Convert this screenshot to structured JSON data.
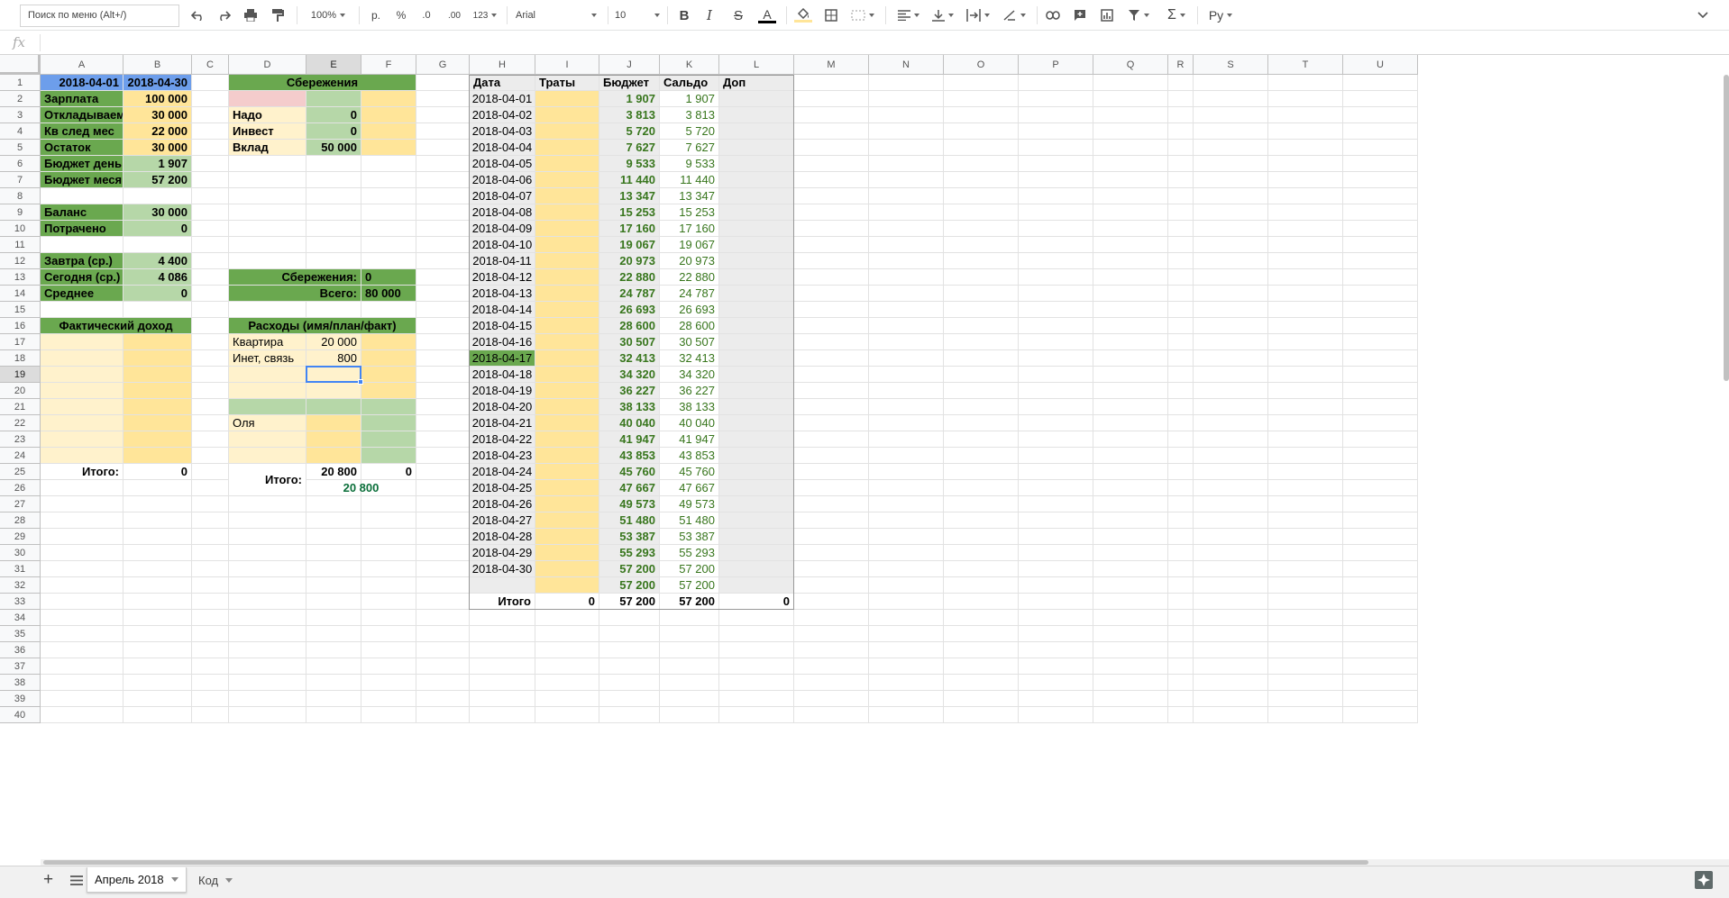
{
  "toolbar": {
    "search_placeholder": "Поиск по меню (Alt+/)",
    "zoom": "100%",
    "currency": "р.",
    "percent": "%",
    "dec_less": ".0",
    "dec_more": ".00",
    "format_more": "123",
    "font": "Arial",
    "font_size": "10",
    "input_tool": "Ру"
  },
  "formula_bar": {
    "fx": "fx",
    "value": ""
  },
  "columns": [
    "A",
    "B",
    "C",
    "D",
    "E",
    "F",
    "G",
    "H",
    "I",
    "J",
    "K",
    "L",
    "M",
    "N",
    "O",
    "P",
    "Q",
    "R",
    "S",
    "T",
    "U"
  ],
  "rows_count": 40,
  "colors": {
    "green_dark": "#6aa84f",
    "green_light": "#b6d7a8",
    "yellow_light": "#fff2cc",
    "yellow": "#ffe599",
    "blue": "#6d9eeb",
    "pink": "#ead1dc",
    "red_light": "#f4cccc",
    "gray": "#ececec",
    "text_green": "#38761d",
    "text_teal": "#0b6f3a"
  },
  "cells": [
    [
      "A1",
      "2018-04-01",
      "b",
      "bl",
      "r"
    ],
    [
      "B1",
      "2018-04-30",
      "b",
      "bl",
      "r"
    ],
    [
      "D1",
      "Сбережения",
      "b",
      "gd",
      "c",
      "span3"
    ],
    [
      "H1",
      "Дата",
      "b",
      "gy"
    ],
    [
      "I1",
      "Траты",
      "b",
      "gy"
    ],
    [
      "J1",
      "Бюджет",
      "b",
      "gy"
    ],
    [
      "K1",
      "Сальдо",
      "b",
      "gy"
    ],
    [
      "L1",
      "Доп",
      "b",
      "gy"
    ],
    [
      "A2",
      "Зарплата",
      "b",
      "gd"
    ],
    [
      "B2",
      "100 000",
      "b",
      "ye",
      "r"
    ],
    [
      "D2",
      "",
      "",
      "rl"
    ],
    [
      "E2",
      "",
      "",
      "gl"
    ],
    [
      "F2",
      "",
      "",
      "ye"
    ],
    [
      "A3",
      "Откладываем",
      "b",
      "gd"
    ],
    [
      "B3",
      "30 000",
      "b",
      "ye",
      "r"
    ],
    [
      "D3",
      "Надо",
      "b",
      "yl"
    ],
    [
      "E3",
      "0",
      "b",
      "gl",
      "r"
    ],
    [
      "F3",
      "",
      "",
      "ye"
    ],
    [
      "A4",
      "Кв след мес",
      "b",
      "gd"
    ],
    [
      "B4",
      "22 000",
      "b",
      "ye",
      "r"
    ],
    [
      "D4",
      "Инвест",
      "b",
      "yl"
    ],
    [
      "E4",
      "0",
      "b",
      "gl",
      "r"
    ],
    [
      "F4",
      "",
      "",
      "ye"
    ],
    [
      "A5",
      "Остаток",
      "b",
      "gd"
    ],
    [
      "B5",
      "30 000",
      "b",
      "ye",
      "r"
    ],
    [
      "D5",
      "Вклад",
      "b",
      "yl"
    ],
    [
      "E5",
      "50 000",
      "b",
      "gl",
      "r"
    ],
    [
      "F5",
      "",
      "",
      "ye"
    ],
    [
      "A6",
      "Бюджет день",
      "b",
      "gd"
    ],
    [
      "B6",
      "1 907",
      "b",
      "gl",
      "r"
    ],
    [
      "A7",
      "Бюджет месяц",
      "b",
      "gd"
    ],
    [
      "B7",
      "57 200",
      "b",
      "gl",
      "r"
    ],
    [
      "A9",
      "Баланс",
      "b",
      "gd"
    ],
    [
      "B9",
      "30 000",
      "b",
      "gl",
      "r"
    ],
    [
      "A10",
      "Потрачено",
      "b",
      "gd"
    ],
    [
      "B10",
      "0",
      "b",
      "gl",
      "r"
    ],
    [
      "A12",
      "Завтра (ср.)",
      "b",
      "gd"
    ],
    [
      "B12",
      "4 400",
      "b",
      "gl",
      "r"
    ],
    [
      "A13",
      "Сегодня (ср.)",
      "b",
      "gd"
    ],
    [
      "B13",
      "4 086",
      "b",
      "gl",
      "r"
    ],
    [
      "D13",
      "Сбережения:",
      "b",
      "gd",
      "r",
      "span2"
    ],
    [
      "F13",
      "0",
      "b",
      "gd"
    ],
    [
      "A14",
      "Среднее",
      "b",
      "gd"
    ],
    [
      "B14",
      "0",
      "b",
      "gl",
      "r"
    ],
    [
      "D14",
      "Всего:",
      "b",
      "gd",
      "r",
      "span2"
    ],
    [
      "F14",
      "80 000",
      "b",
      "gd"
    ],
    [
      "A16",
      "Фактический доход",
      "b",
      "gd",
      "c",
      "span2"
    ],
    [
      "D16",
      "Расходы (имя/план/факт)",
      "b",
      "gd",
      "c",
      "span3"
    ],
    [
      "A17",
      "",
      "",
      "yl"
    ],
    [
      "B17",
      "",
      "",
      "ye"
    ],
    [
      "D17",
      "Квартира",
      "",
      "yl"
    ],
    [
      "E17",
      "20 000",
      "",
      "yl",
      "r"
    ],
    [
      "F17",
      "",
      "",
      "ye"
    ],
    [
      "A18",
      "",
      "",
      "yl"
    ],
    [
      "B18",
      "",
      "",
      "ye"
    ],
    [
      "D18",
      "Инет, связь",
      "",
      "yl"
    ],
    [
      "E18",
      "800",
      "",
      "yl",
      "r"
    ],
    [
      "F18",
      "",
      "",
      "ye"
    ],
    [
      "A19",
      "",
      "",
      "yl"
    ],
    [
      "B19",
      "",
      "",
      "ye"
    ],
    [
      "D19",
      "",
      "",
      "yl"
    ],
    [
      "E19",
      "",
      "",
      "yl"
    ],
    [
      "F19",
      "",
      "",
      "ye"
    ],
    [
      "A20",
      "",
      "",
      "yl"
    ],
    [
      "B20",
      "",
      "",
      "ye"
    ],
    [
      "D20",
      "",
      "",
      "yl"
    ],
    [
      "E20",
      "",
      "",
      "yl"
    ],
    [
      "F20",
      "",
      "",
      "ye"
    ],
    [
      "A21",
      "",
      "",
      "yl"
    ],
    [
      "B21",
      "",
      "",
      "ye"
    ],
    [
      "D21",
      "",
      "",
      "gl"
    ],
    [
      "E21",
      "",
      "",
      "gl"
    ],
    [
      "F21",
      "",
      "",
      "gl"
    ],
    [
      "A22",
      "",
      "",
      "yl"
    ],
    [
      "B22",
      "",
      "",
      "ye"
    ],
    [
      "D22",
      "Оля",
      "",
      "yl"
    ],
    [
      "E22",
      "",
      "",
      "ye"
    ],
    [
      "F22",
      "",
      "",
      "gl"
    ],
    [
      "A23",
      "",
      "",
      "yl"
    ],
    [
      "B23",
      "",
      "",
      "ye"
    ],
    [
      "D23",
      "",
      "",
      "yl"
    ],
    [
      "E23",
      "",
      "",
      "ye"
    ],
    [
      "F23",
      "",
      "",
      "gl"
    ],
    [
      "A24",
      "",
      "",
      "yl"
    ],
    [
      "B24",
      "",
      "",
      "ye"
    ],
    [
      "D24",
      "",
      "",
      "yl"
    ],
    [
      "E24",
      "",
      "",
      "ye"
    ],
    [
      "F24",
      "",
      "",
      "gl"
    ],
    [
      "A25",
      "Итого:",
      "b",
      "",
      "r"
    ],
    [
      "B25",
      "0",
      "b",
      "",
      "r"
    ],
    [
      "E25",
      "20 800",
      "b",
      "",
      "r"
    ],
    [
      "F25",
      "0",
      "b",
      "",
      "r"
    ],
    [
      "D25",
      "Итого:",
      "b",
      "",
      "r"
    ],
    [
      "E26",
      "20 800",
      "tt",
      "",
      "c",
      "span2"
    ]
  ],
  "budget": {
    "dates": [
      "2018-04-01",
      "2018-04-02",
      "2018-04-03",
      "2018-04-04",
      "2018-04-05",
      "2018-04-06",
      "2018-04-07",
      "2018-04-08",
      "2018-04-09",
      "2018-04-10",
      "2018-04-11",
      "2018-04-12",
      "2018-04-13",
      "2018-04-14",
      "2018-04-15",
      "2018-04-16",
      "2018-04-17",
      "2018-04-18",
      "2018-04-19",
      "2018-04-20",
      "2018-04-21",
      "2018-04-22",
      "2018-04-23",
      "2018-04-24",
      "2018-04-25",
      "2018-04-26",
      "2018-04-27",
      "2018-04-28",
      "2018-04-29",
      "2018-04-30",
      ""
    ],
    "budget": [
      "1 907",
      "3 813",
      "5 720",
      "7 627",
      "9 533",
      "11 440",
      "13 347",
      "15 253",
      "17 160",
      "19 067",
      "20 973",
      "22 880",
      "24 787",
      "26 693",
      "28 600",
      "30 507",
      "32 413",
      "34 320",
      "36 227",
      "38 133",
      "40 040",
      "41 947",
      "43 853",
      "45 760",
      "47 667",
      "49 573",
      "51 480",
      "53 387",
      "55 293",
      "57 200",
      "57 200"
    ],
    "saldo": [
      "1 907",
      "3 813",
      "5 720",
      "7 627",
      "9 533",
      "11 440",
      "13 347",
      "15 253",
      "17 160",
      "19 067",
      "20 973",
      "22 880",
      "24 787",
      "26 693",
      "28 600",
      "30 507",
      "32 413",
      "34 320",
      "36 227",
      "38 133",
      "40 040",
      "41 947",
      "43 853",
      "45 760",
      "47 667",
      "49 573",
      "51 480",
      "53 387",
      "55 293",
      "57 200",
      "57 200"
    ],
    "today_row": 16,
    "total_label": "Итого",
    "total_traty": "0",
    "total_budget": "57 200",
    "total_saldo": "57 200",
    "total_dop": "0"
  },
  "selected_cell": "E19",
  "sheets": [
    {
      "name": "Апрель 2018",
      "active": true
    },
    {
      "name": "Код",
      "active": false
    }
  ]
}
